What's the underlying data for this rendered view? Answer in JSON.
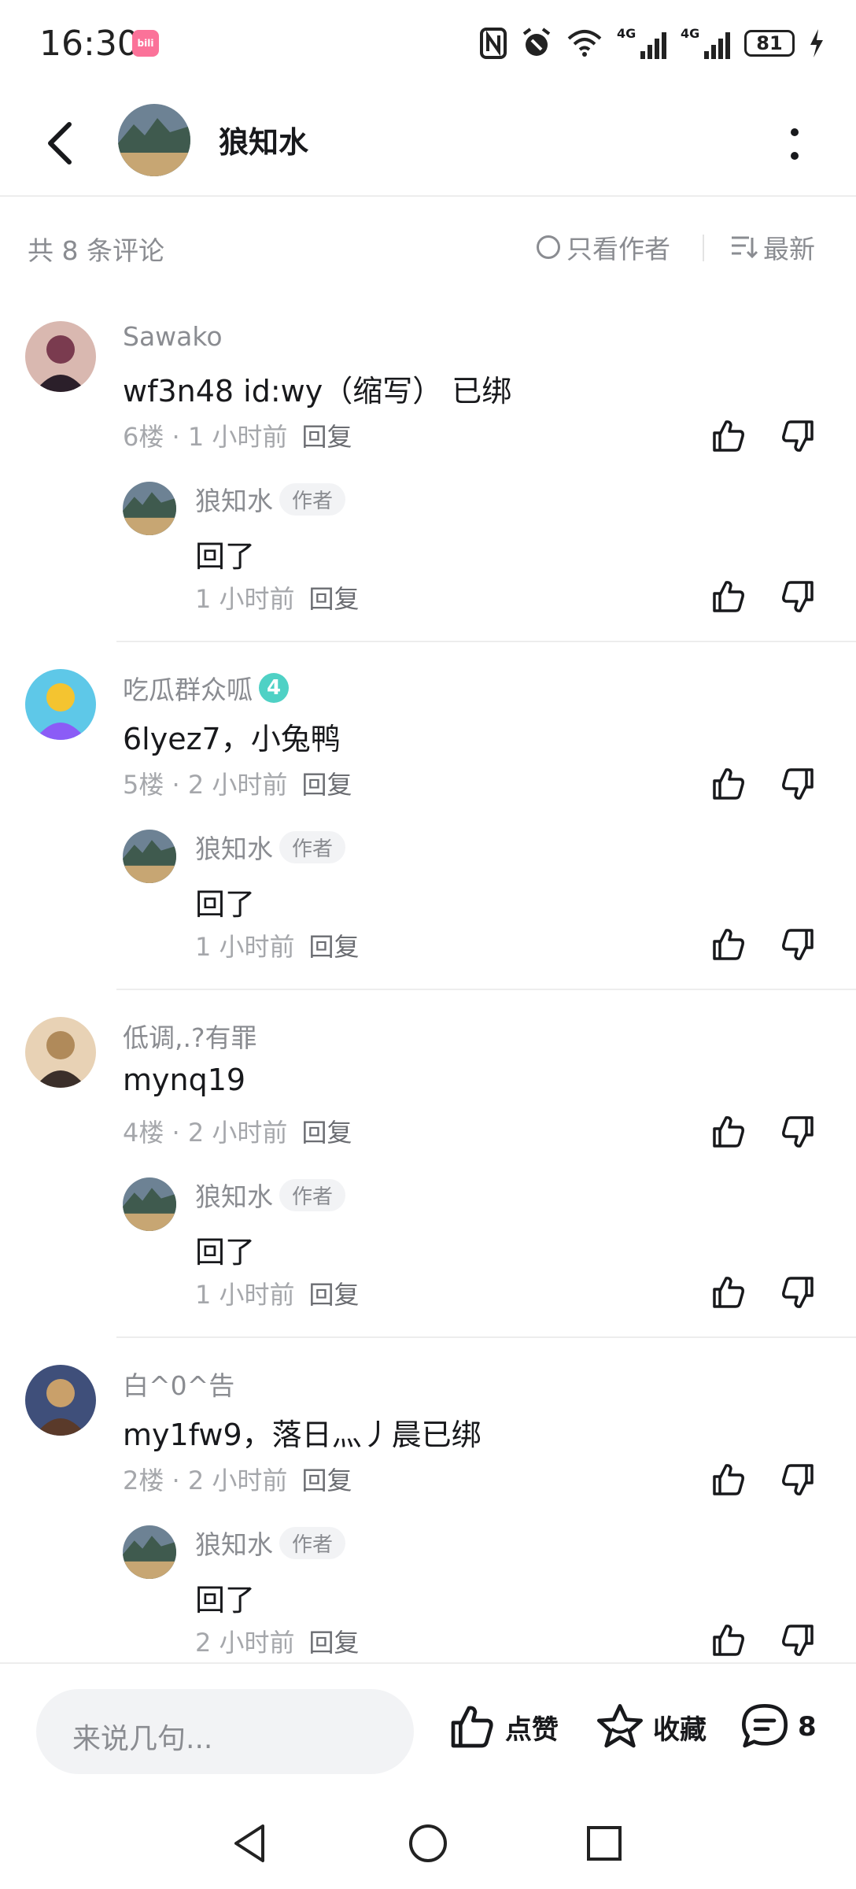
{
  "status_bar": {
    "time": "16:30",
    "app_icon": "bilibili-icon",
    "battery": "81",
    "net1": "4G",
    "net2": "4G",
    "icons": [
      "nfc-icon",
      "alarm-icon",
      "wifi-icon",
      "signal-icon",
      "signal-icon",
      "battery-icon",
      "charging-icon"
    ]
  },
  "header": {
    "title": "狼知水",
    "back_icon": "back-arrow-icon",
    "more_icon": "more-vertical-icon"
  },
  "filter": {
    "count_label": "共 8 条评论",
    "only_author_label": "只看作者",
    "sort_label": "最新"
  },
  "comments": [
    {
      "user": "Sawako",
      "text": "wf3n48 id:wy（缩写） 已绑",
      "floor": "6楼",
      "time": "1 小时前",
      "reply_label": "回复",
      "level": "",
      "reply": {
        "user": "狼知水",
        "badge": "作者",
        "text": "回了",
        "time": "1 小时前",
        "reply_label": "回复"
      }
    },
    {
      "user": "吃瓜群众呱",
      "text": "6lyez7，小兔鸭",
      "floor": "5楼",
      "time": "2 小时前",
      "reply_label": "回复",
      "level": "4",
      "reply": {
        "user": "狼知水",
        "badge": "作者",
        "text": "回了",
        "time": "1 小时前",
        "reply_label": "回复"
      }
    },
    {
      "user": "低调,.?有罪",
      "text": "mynq19",
      "floor": "4楼",
      "time": "2 小时前",
      "reply_label": "回复",
      "level": "",
      "reply": {
        "user": "狼知水",
        "badge": "作者",
        "text": "回了",
        "time": "1 小时前",
        "reply_label": "回复"
      }
    },
    {
      "user": "白^0^告",
      "text": "my1fw9，落日灬丿晨已绑",
      "floor": "2楼",
      "time": "2 小时前",
      "reply_label": "回复",
      "level": "",
      "reply": {
        "user": "狼知水",
        "badge": "作者",
        "text": "回了",
        "time": "2 小时前",
        "reply_label": "回复"
      }
    }
  ],
  "bottom_bar": {
    "input_placeholder": "来说几句...",
    "like_label": "点赞",
    "favorite_label": "收藏",
    "comment_count": "8"
  },
  "nav": {
    "back": "nav-back-icon",
    "home": "nav-home-icon",
    "recents": "nav-recents-icon"
  },
  "colors": {
    "primary_text": "#18191c",
    "secondary_text": "#8a8c91",
    "divider": "#ededed",
    "level_badge": "#4fd1c5"
  }
}
